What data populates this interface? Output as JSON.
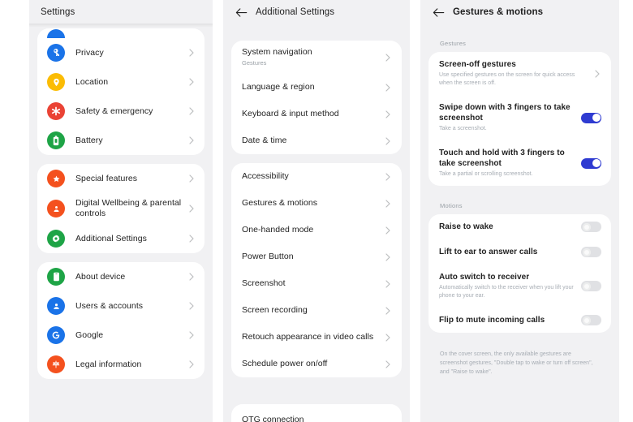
{
  "colors": {
    "background": "#f1f1f3",
    "card": "#ffffff",
    "toggle_on": "#2f3bd1",
    "toggle_off": "#e0e1e4",
    "blue": "#1a73e8",
    "yellow": "#fbbc04",
    "red": "#ea4335",
    "green": "#1ea446",
    "orange": "#f4511e"
  },
  "left_panel": {
    "title": "Settings",
    "groups": [
      {
        "items": [
          {
            "label": "Privacy",
            "icon": "privacy-icon",
            "color": "#1a73e8",
            "chevron": "chevron-right-icon"
          },
          {
            "label": "Location",
            "icon": "location-icon",
            "color": "#fbbc04",
            "chevron": "chevron-right-icon"
          },
          {
            "label": "Safety & emergency",
            "icon": "safety-emergency-icon",
            "color": "#ea4335",
            "chevron": "chevron-right-icon"
          },
          {
            "label": "Battery",
            "icon": "battery-icon",
            "color": "#1ea446",
            "chevron": "chevron-right-icon"
          }
        ]
      },
      {
        "items": [
          {
            "label": "Special features",
            "icon": "star-icon",
            "color": "#f4511e",
            "chevron": "chevron-right-icon"
          },
          {
            "label": "Digital Wellbeing & parental controls",
            "icon": "digital-wellbeing-icon",
            "color": "#f4511e",
            "chevron": "chevron-right-icon"
          },
          {
            "label": "Additional Settings",
            "icon": "gear-icon",
            "color": "#1ea446",
            "chevron": "chevron-right-icon"
          }
        ]
      },
      {
        "items": [
          {
            "label": "About device",
            "icon": "phone-icon",
            "color": "#1ea446",
            "chevron": "chevron-right-icon"
          },
          {
            "label": "Users & accounts",
            "icon": "user-icon",
            "color": "#1a73e8",
            "chevron": "chevron-right-icon"
          },
          {
            "label": "Google",
            "icon": "google-icon",
            "color": "#1a73e8",
            "chevron": "chevron-right-icon"
          },
          {
            "label": "Legal information",
            "icon": "legal-icon",
            "color": "#f4511e",
            "chevron": "chevron-right-icon"
          }
        ]
      }
    ]
  },
  "mid_panel": {
    "title": "Additional Settings",
    "back_icon": "back-arrow-icon",
    "groups": [
      {
        "items": [
          {
            "label": "System navigation",
            "sub": "Gestures"
          },
          {
            "label": "Language & region",
            "sub": ""
          },
          {
            "label": "Keyboard & input method",
            "sub": ""
          },
          {
            "label": "Date & time",
            "sub": ""
          }
        ]
      },
      {
        "items": [
          {
            "label": "Accessibility",
            "sub": ""
          },
          {
            "label": "Gestures & motions",
            "sub": ""
          },
          {
            "label": "One-handed mode",
            "sub": ""
          },
          {
            "label": "Power Button",
            "sub": ""
          },
          {
            "label": "Screenshot",
            "sub": ""
          },
          {
            "label": "Screen recording",
            "sub": ""
          },
          {
            "label": "Retouch appearance in video calls",
            "sub": ""
          },
          {
            "label": "Schedule power on/off",
            "sub": ""
          }
        ]
      }
    ],
    "partial_next_item": "OTG connection"
  },
  "right_panel": {
    "title": "Gestures & motions",
    "back_icon": "back-arrow-icon",
    "sections": [
      {
        "label": "Gestures",
        "items": [
          {
            "label": "Screen-off gestures",
            "sub": "Use specified gestures on the screen for quick access when the screen is off.",
            "control": "chevron",
            "state": ""
          },
          {
            "label": "Swipe down with 3 fingers to take screenshot",
            "sub": "Take a screenshot.",
            "control": "toggle",
            "state": "on"
          },
          {
            "label": "Touch and hold with 3 fingers to take screenshot",
            "sub": "Take a partial or scrolling screenshot.",
            "control": "toggle",
            "state": "on"
          }
        ]
      },
      {
        "label": "Motions",
        "items": [
          {
            "label": "Raise to wake",
            "sub": "",
            "control": "toggle",
            "state": "off"
          },
          {
            "label": "Lift to ear to answer calls",
            "sub": "",
            "control": "toggle",
            "state": "off"
          },
          {
            "label": "Auto switch to receiver",
            "sub": "Automatically switch to the receiver when you lift your phone to your ear.",
            "control": "toggle",
            "state": "off"
          },
          {
            "label": "Flip to mute incoming calls",
            "sub": "",
            "control": "toggle",
            "state": "off"
          }
        ]
      }
    ],
    "footnote": "On the cover screen, the only available gestures are screenshot gestures, \"Double tap to wake or turn off screen\", and \"Raise to wake\"."
  }
}
